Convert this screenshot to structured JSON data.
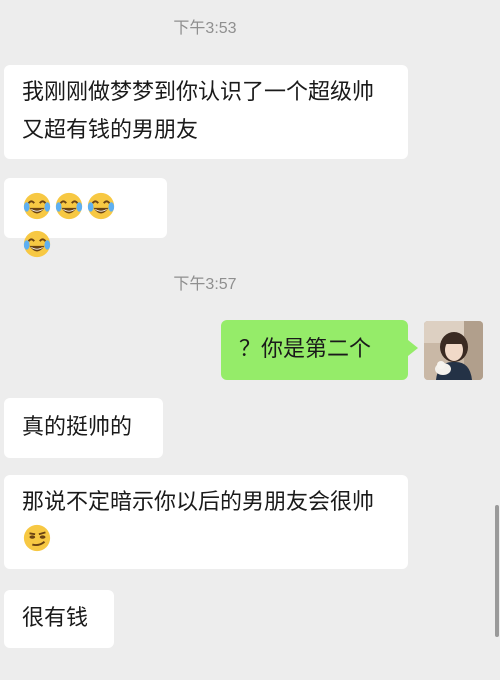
{
  "chat": {
    "timestamps": [
      "下午3:53",
      "下午3:57"
    ],
    "messages": [
      {
        "sender": "other",
        "text": "我刚刚做梦梦到你认识了一个超级帅又超有钱的男朋友"
      },
      {
        "sender": "other",
        "emoji": [
          "face-with-tears-of-joy",
          "face-with-tears-of-joy",
          "face-with-tears-of-joy",
          "face-with-tears-of-joy"
        ]
      },
      {
        "sender": "me",
        "text": "？你是第二个"
      },
      {
        "sender": "other",
        "text": "真的挺帅的"
      },
      {
        "sender": "other",
        "text": "那说不定暗示你以后的男朋友会很帅",
        "trailing_emoji": "smirking-face"
      },
      {
        "sender": "other",
        "text": "很有钱"
      }
    ]
  },
  "colors": {
    "background": "#ededed",
    "incoming_bubble": "#ffffff",
    "outgoing_bubble": "#95ec69",
    "timestamp": "#8f8f8f"
  }
}
